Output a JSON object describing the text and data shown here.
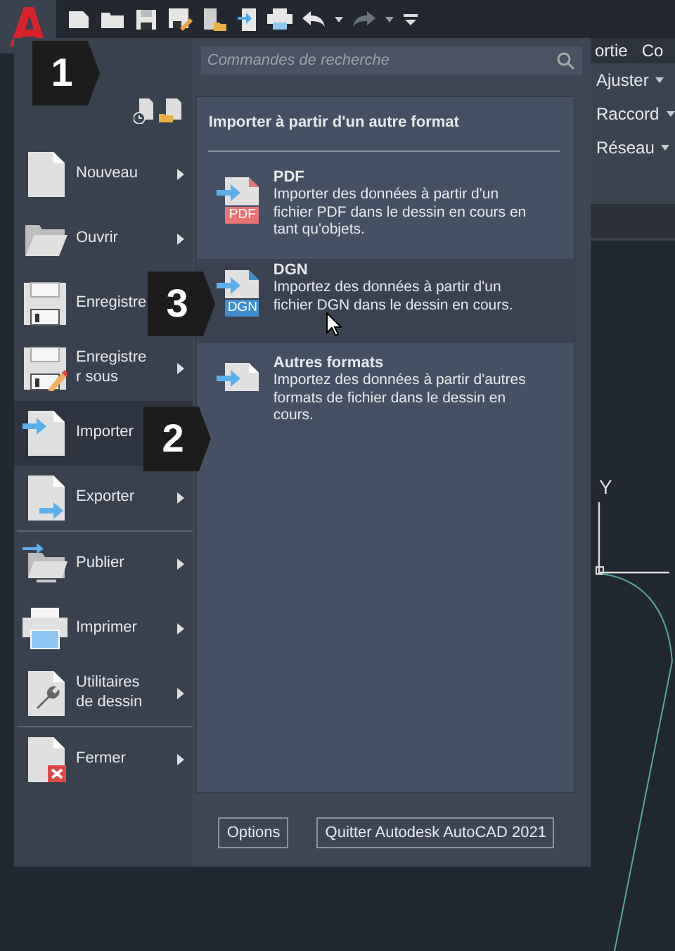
{
  "ribbon": {
    "tabs": [
      "ortie",
      "Co"
    ],
    "tools": [
      "Ajuster",
      "Raccord",
      "Réseau"
    ]
  },
  "canvas": {
    "axis_label": "Y"
  },
  "search": {
    "placeholder": "Commandes de recherche"
  },
  "menu_items": [
    {
      "label": "Nouveau",
      "has_submenu": true,
      "selected": false,
      "separator_before": false
    },
    {
      "label": "Ouvrir",
      "has_submenu": true,
      "selected": false,
      "separator_before": false
    },
    {
      "label": "Enregistre",
      "selected": false,
      "separator_before": false
    },
    {
      "label": "Enregistre r sous",
      "has_submenu": true,
      "selected": false,
      "separator_before": false
    },
    {
      "label": "Importer",
      "selected": true,
      "separator_before": false
    },
    {
      "label": "Exporter",
      "has_submenu": true,
      "selected": false,
      "separator_before": false
    },
    {
      "label": "Publier",
      "has_submenu": true,
      "selected": false,
      "separator_before": true
    },
    {
      "label": "Imprimer",
      "has_submenu": true,
      "selected": false,
      "separator_before": false
    },
    {
      "label": "Utilitaires de dessin",
      "has_submenu": true,
      "selected": false,
      "separator_before": false
    },
    {
      "label": "Fermer",
      "has_submenu": true,
      "selected": false,
      "separator_before": true
    }
  ],
  "submenu": {
    "title": "Importer à partir d'un autre format",
    "items": [
      {
        "title": "PDF",
        "description": "Importer des données à partir d'un fichier PDF dans le dessin en cours en tant qu'objets.",
        "file_tag": "PDF",
        "color": "#e87474",
        "selected": false
      },
      {
        "title": "DGN",
        "description": "Importez des données à partir d'un fichier DGN dans le dessin en cours.",
        "file_tag": "DGN",
        "color": "#3f8fd0",
        "selected": true
      },
      {
        "title": "Autres formats",
        "description": "Importez des données à partir d'autres formats de fichier dans le dessin en cours.",
        "selected": false
      }
    ]
  },
  "buttons": [
    "Options",
    "Quitter Autodesk AutoCAD 2021"
  ],
  "callouts": [
    {
      "number": "1"
    },
    {
      "number": "2"
    },
    {
      "number": "3"
    }
  ]
}
